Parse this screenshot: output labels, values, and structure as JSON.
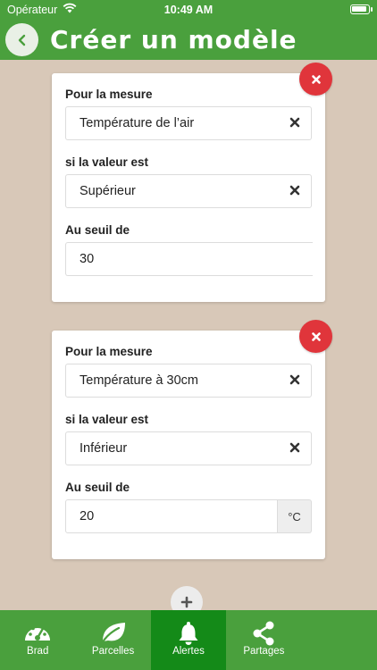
{
  "status_bar": {
    "carrier": "Opérateur",
    "time": "10:49 AM"
  },
  "header": {
    "title": "Créer un modèle"
  },
  "conditions": [
    {
      "measure_label": "Pour la mesure",
      "measure_value": "Température de l’air",
      "comparison_label": "si la valeur est",
      "comparison_value": "Supérieur",
      "threshold_label": "Au seuil de",
      "threshold_value": "30",
      "unit": ""
    },
    {
      "measure_label": "Pour la mesure",
      "measure_value": "Température à 30cm",
      "comparison_label": "si la valeur est",
      "comparison_value": "Inférieur",
      "threshold_label": "Au seuil de",
      "threshold_value": "20",
      "unit": "°C"
    }
  ],
  "tabs": [
    {
      "label": "Brad",
      "icon": "gauge-icon",
      "active": false
    },
    {
      "label": "Parcelles",
      "icon": "leaf-icon",
      "active": false
    },
    {
      "label": "Alertes",
      "icon": "bell-icon",
      "active": true
    },
    {
      "label": "Partages",
      "icon": "share-icon",
      "active": false
    }
  ],
  "colors": {
    "brand_green": "#4aa03d",
    "active_tab": "#148a18",
    "delete_red": "#e0353b",
    "background": "#d8c8b8"
  }
}
